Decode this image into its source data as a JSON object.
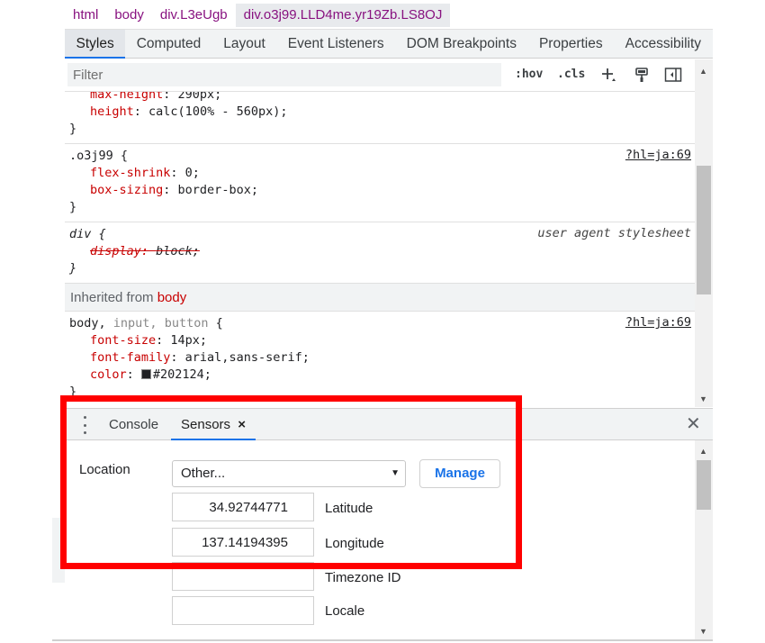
{
  "breadcrumb": [
    "html",
    "body",
    "div.L3eUgb",
    "div.o3j99.LLD4me.yr19Zb.LS8OJ"
  ],
  "tabs": [
    "Styles",
    "Computed",
    "Layout",
    "Event Listeners",
    "DOM Breakpoints",
    "Properties",
    "Accessibility"
  ],
  "filter": {
    "placeholder": "Filter",
    "hov": ":hov",
    "cls": ".cls"
  },
  "styles": {
    "rule0": {
      "decls": [
        {
          "prop": "max-height",
          "val": "290px;"
        },
        {
          "prop": "height",
          "val": "calc(100% - 560px);"
        }
      ]
    },
    "rule1": {
      "selector": ".o3j99 {",
      "source": "?hl=ja:69",
      "decls": [
        {
          "prop": "flex-shrink",
          "val": "0;"
        },
        {
          "prop": "box-sizing",
          "val": "border-box;"
        }
      ]
    },
    "rule2": {
      "selector": "div {",
      "source": "user agent stylesheet",
      "decl": {
        "prop": "display",
        "val": "block;"
      }
    },
    "inherited": {
      "text": "Inherited from",
      "tag": "body"
    },
    "rule3": {
      "selector_main": "body,",
      "selector_dim1": "input,",
      "selector_dim2": "button",
      "brace": "{",
      "source": "?hl=ja:69",
      "decls": [
        {
          "prop": "font-size",
          "val": "14px;"
        },
        {
          "prop": "font-family",
          "val": "arial,sans-serif;"
        },
        {
          "prop": "color",
          "val": "#202124;"
        }
      ],
      "close": "}"
    }
  },
  "drawer": {
    "tabs": [
      "Console",
      "Sensors"
    ],
    "close_tab": "×",
    "close": "✕"
  },
  "sensors": {
    "location_label": "Location",
    "location_value": "Other...",
    "manage": "Manage",
    "latitude_value": "34.92744771",
    "latitude_label": "Latitude",
    "longitude_value": "137.14194395",
    "longitude_label": "Longitude",
    "timezone_value": "",
    "timezone_label": "Timezone ID",
    "locale_value": "",
    "locale_label": "Locale"
  },
  "colors": {
    "highlight": "#ff0000",
    "accent": "#1a73e8"
  }
}
